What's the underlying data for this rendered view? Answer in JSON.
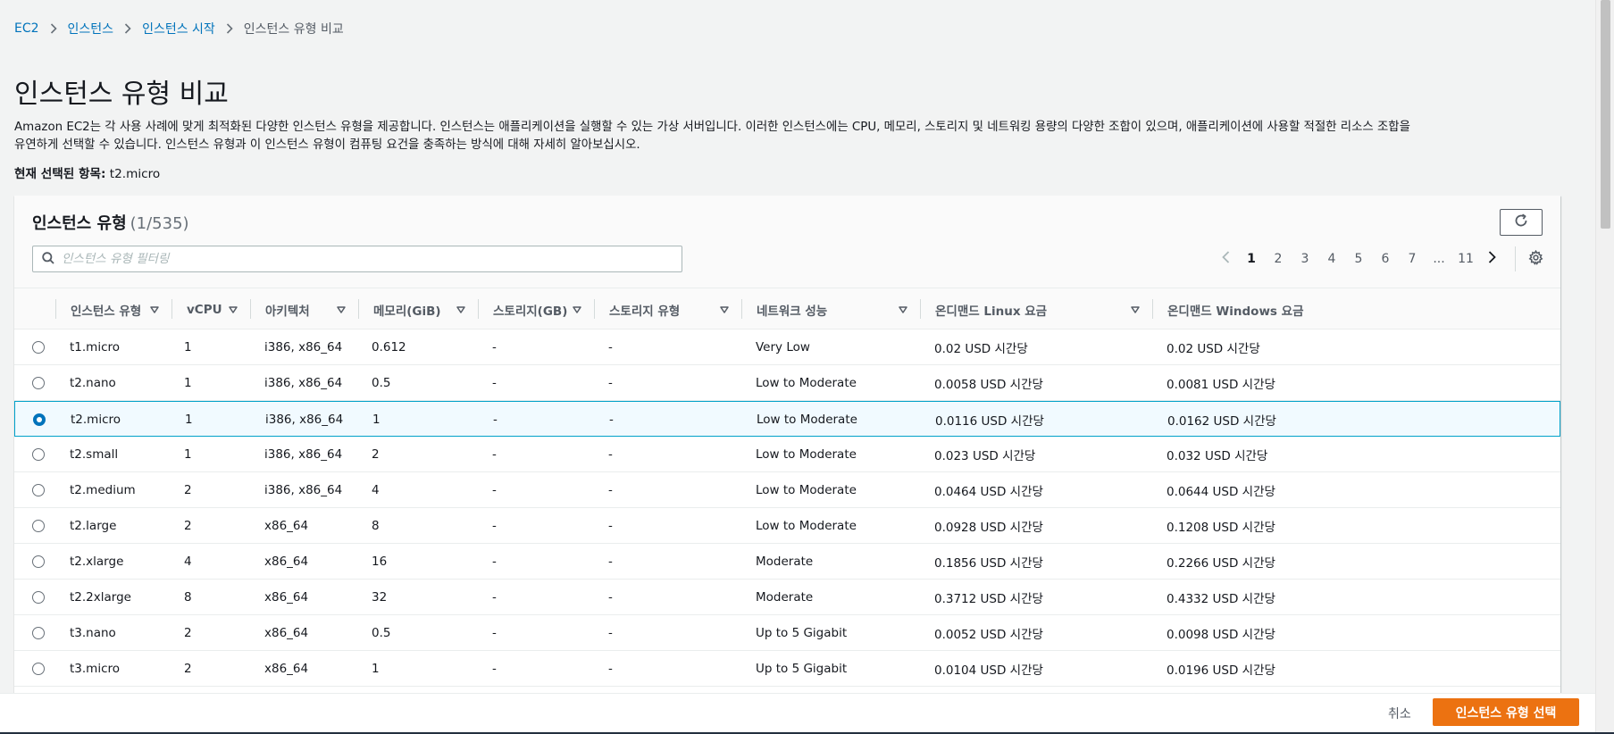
{
  "breadcrumb": {
    "items": [
      "EC2",
      "인스턴스",
      "인스턴스 시작"
    ],
    "current": "인스턴스 유형 비교"
  },
  "page": {
    "title": "인스턴스 유형 비교",
    "description_1": "Amazon EC2는 각 사용 사례에 맞게 최적화된 다양한 인스턴스 유형을 제공합니다. 인스턴스는 애플리케이션을 실행할 수 있는 가상 서버입니다. 이러한 인스턴스에는 CPU, 메모리, 스토리지 및 네트워킹 용량의 다양한 조합이 있으며, 애플리케이션에 사용할 적절한 리소스 조합을",
    "description_2": "유연하게 선택할 수 있습니다. 인스턴스 유형과 이 인스턴스 유형이 컴퓨팅 요건을 충족하는 방식에 대해 자세히 알아보십시오.",
    "selected_label": "현재 선택된 항목:",
    "selected_value": "t2.micro"
  },
  "panel": {
    "title": "인스턴스 유형",
    "count": "(1/535)",
    "filter_placeholder": "인스턴스 유형 필터링",
    "pages": [
      "1",
      "2",
      "3",
      "4",
      "5",
      "6",
      "7",
      "...",
      "11"
    ],
    "active_page": "1"
  },
  "table": {
    "columns": [
      "인스턴스 유형",
      "vCPU",
      "아키텍처",
      "메모리(GiB)",
      "스토리지(GB)",
      "스토리지 유형",
      "네트워크 성능",
      "온디맨드 Linux 요금",
      "온디맨드 Windows 요금"
    ],
    "selected_row": 2,
    "rows": [
      [
        "t1.micro",
        "1",
        "i386, x86_64",
        "0.612",
        "-",
        "-",
        "Very Low",
        "0.02 USD 시간당",
        "0.02 USD 시간당"
      ],
      [
        "t2.nano",
        "1",
        "i386, x86_64",
        "0.5",
        "-",
        "-",
        "Low to Moderate",
        "0.0058 USD 시간당",
        "0.0081 USD 시간당"
      ],
      [
        "t2.micro",
        "1",
        "i386, x86_64",
        "1",
        "-",
        "-",
        "Low to Moderate",
        "0.0116 USD 시간당",
        "0.0162 USD 시간당"
      ],
      [
        "t2.small",
        "1",
        "i386, x86_64",
        "2",
        "-",
        "-",
        "Low to Moderate",
        "0.023 USD 시간당",
        "0.032 USD 시간당"
      ],
      [
        "t2.medium",
        "2",
        "i386, x86_64",
        "4",
        "-",
        "-",
        "Low to Moderate",
        "0.0464 USD 시간당",
        "0.0644 USD 시간당"
      ],
      [
        "t2.large",
        "2",
        "x86_64",
        "8",
        "-",
        "-",
        "Low to Moderate",
        "0.0928 USD 시간당",
        "0.1208 USD 시간당"
      ],
      [
        "t2.xlarge",
        "4",
        "x86_64",
        "16",
        "-",
        "-",
        "Moderate",
        "0.1856 USD 시간당",
        "0.2266 USD 시간당"
      ],
      [
        "t2.2xlarge",
        "8",
        "x86_64",
        "32",
        "-",
        "-",
        "Moderate",
        "0.3712 USD 시간당",
        "0.4332 USD 시간당"
      ],
      [
        "t3.nano",
        "2",
        "x86_64",
        "0.5",
        "-",
        "-",
        "Up to 5 Gigabit",
        "0.0052 USD 시간당",
        "0.0098 USD 시간당"
      ],
      [
        "t3.micro",
        "2",
        "x86_64",
        "1",
        "-",
        "-",
        "Up to 5 Gigabit",
        "0.0104 USD 시간당",
        "0.0196 USD 시간당"
      ]
    ]
  },
  "footer": {
    "cancel_label": "취소",
    "primary_label": "인스턴스 유형 선택"
  },
  "colors": {
    "link": "#0073bb",
    "primary": "#ec7211",
    "selected_row_border": "#00a1c9",
    "selected_row_bg": "#f1faff"
  },
  "icons": [
    "chevron-right-icon",
    "refresh-icon",
    "search-icon",
    "chevron-left-icon",
    "gear-icon",
    "caret-down-icon"
  ]
}
